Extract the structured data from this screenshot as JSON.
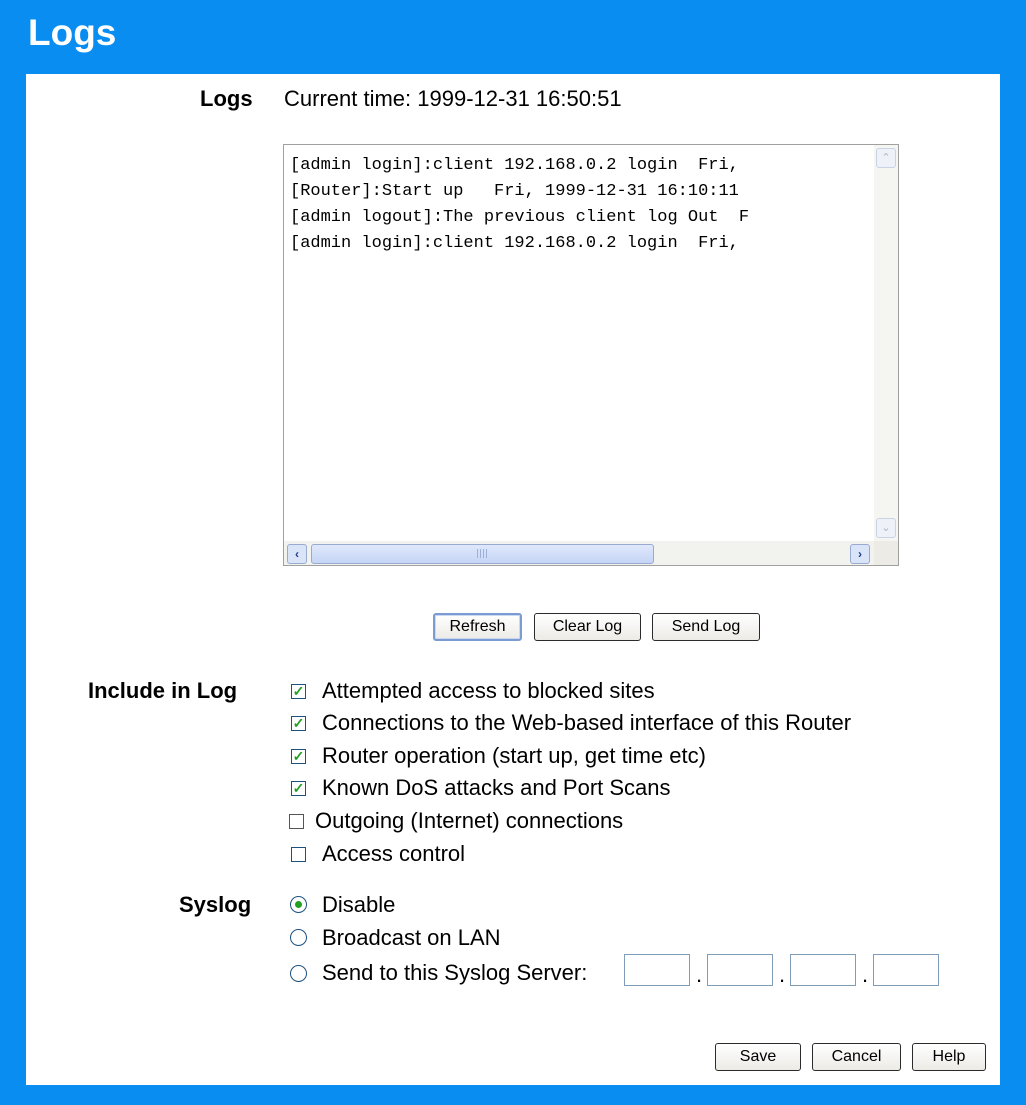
{
  "page": {
    "title": "Logs"
  },
  "logs": {
    "label": "Logs",
    "current_time_label": "Current time:",
    "current_time": "1999-12-31 16:50:51",
    "entries": "[admin login]:client 192.168.0.2 login  Fri,\n[Router]:Start up   Fri, 1999-12-31 16:10:11\n[admin logout]:The previous client log Out  F\n[admin login]:client 192.168.0.2 login  Fri,",
    "buttons": {
      "refresh": "Refresh",
      "clear": "Clear Log",
      "send": "Send Log"
    }
  },
  "include": {
    "label": "Include in Log",
    "options": [
      {
        "label": "Attempted access to blocked sites",
        "checked": true
      },
      {
        "label": "Connections to the Web-based interface of this Router",
        "checked": true
      },
      {
        "label": "Router operation (start up, get time etc)",
        "checked": true
      },
      {
        "label": "Known DoS attacks and Port Scans",
        "checked": true
      },
      {
        "label": "Outgoing (Internet) connections",
        "checked": false
      },
      {
        "label": "Access control",
        "checked": false
      }
    ]
  },
  "syslog": {
    "label": "Syslog",
    "options": [
      {
        "label": "Disable",
        "selected": true
      },
      {
        "label": "Broadcast on LAN",
        "selected": false
      },
      {
        "label": "Send to this Syslog Server:",
        "selected": false
      }
    ],
    "server_ip": [
      "",
      "",
      "",
      ""
    ]
  },
  "footer": {
    "save": "Save",
    "cancel": "Cancel",
    "help": "Help"
  },
  "colors": {
    "background": "#0a8df0",
    "check": "#21a121"
  },
  "icons": {
    "scroll_up": "up-arrow-icon",
    "scroll_down": "down-arrow-icon",
    "scroll_left": "left-arrow-icon",
    "scroll_right": "right-arrow-icon"
  }
}
